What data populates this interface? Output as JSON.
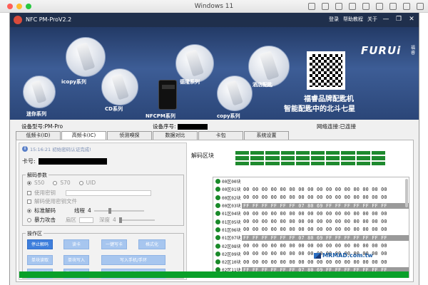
{
  "mac": {
    "title": "Windows 11"
  },
  "app": {
    "title": "NFC PM-ProV2.2",
    "menu": {
      "login": "登录",
      "help": "帮助教程",
      "about": "关于"
    },
    "controls": {
      "min": "—",
      "max": "❐",
      "close": "✕"
    }
  },
  "banner": {
    "brand": "FURUi",
    "brand_sub": "福睿",
    "slogan1": "福睿品牌配匙机",
    "slogan2": "智能配匙中的北斗七星",
    "products": [
      "迷你系列",
      "icopy系列",
      "CD系列",
      "NFCPM系列",
      "德隆系列",
      "copy系列",
      "酒店配匙"
    ]
  },
  "info": {
    "model_label": "设备型号:PM-Pro",
    "serial_label": "设备序号:",
    "network": "网络连接:已连接"
  },
  "tabs": [
    "低频卡(ID)",
    "高频卡(IC)",
    "侦测嗅探",
    "数据对比",
    "卡包",
    "系统设置"
  ],
  "left": {
    "status": "15:16:21 初始密码认证完成!",
    "card_label": "卡号:",
    "params": {
      "legend": "解码参数",
      "radios": [
        "S50",
        "S70",
        "UID"
      ],
      "use_key": "使用密钥",
      "use_keyfile": "解码使用密钥文件",
      "std_decode": "标准解码",
      "thread_label": "线程",
      "thread_value": "4",
      "brute": "暴力攻击",
      "sector_label": "扇区",
      "depth_label": "深度",
      "depth_value": "4"
    },
    "ops": {
      "legend": "操作区",
      "buttons": [
        "停止解码",
        "读卡",
        "一键写卡",
        "格式化",
        "单块读取",
        "单块写入",
        "写入手机/手环",
        "观测计时",
        "导入DUMP",
        "保存数据"
      ]
    }
  },
  "right": {
    "title": "解码区块",
    "rows": [
      {
        "label": "00区00块",
        "hex": "",
        "gray": false
      },
      {
        "label": "00区01块",
        "hex": "00 00 00 00 00 00 00 00 00 00 00 00 00 00 00 00",
        "gray": false
      },
      {
        "label": "00区02块",
        "hex": "00 00 00 00 00 00 00 00 00 00 00 00 00 00 00 00",
        "gray": false
      },
      {
        "label": "00区03块",
        "hex": "FF FF FF FF FF FF 07 80 69 FF FF FF FF FF FF FF",
        "gray": true
      },
      {
        "label": "01区04块",
        "hex": "00 00 00 00 00 00 00 00 00 00 00 00 00 00 00 00",
        "gray": false
      },
      {
        "label": "01区05块",
        "hex": "00 00 00 00 00 00 00 00 00 00 00 00 00 00 00 00",
        "gray": false
      },
      {
        "label": "01区06块",
        "hex": "00 00 00 00 00 00 00 00 00 00 00 00 00 00 00 00",
        "gray": false
      },
      {
        "label": "01区07块",
        "hex": "FF FF FF FF FF FF 07 80 69 FF FF FF FF FF FF FF",
        "gray": true
      },
      {
        "label": "02区08块",
        "hex": "00 00 00 00 00 00 00 00 00 00 00 00 00 00 00 00",
        "gray": false
      },
      {
        "label": "02区09块",
        "hex": "00 00 00 00 00 00 00 00 00 00 00 00 00 00 00 00",
        "gray": false
      },
      {
        "label": "02区10块",
        "hex": "00 00 00 00 00 00 00 00 00 00 00 00 00 00 00 00",
        "gray": false
      },
      {
        "label": "02区11块",
        "hex": "FF FF FF FF FF FF 07 80 69 FF FF FF FF FF FF FF",
        "gray": true
      }
    ]
  },
  "watermark": "MRMAD.com.tw",
  "colors": {
    "accent": "#3f7fdc",
    "green": "#1e8a2e",
    "titlebar": "#1f2f4c"
  }
}
